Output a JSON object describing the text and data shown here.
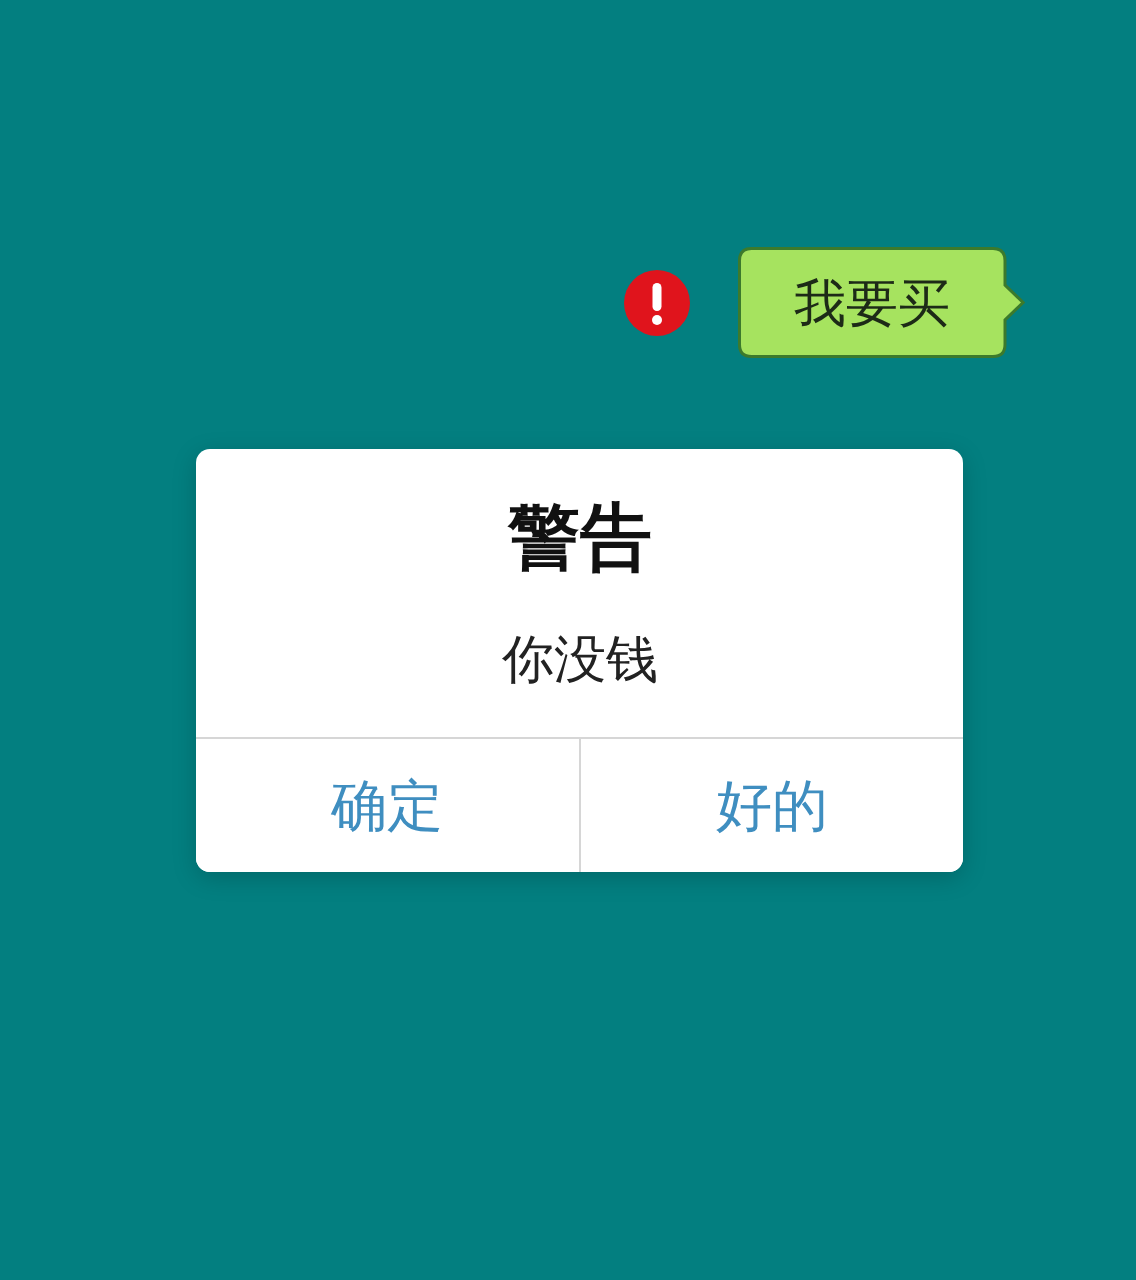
{
  "message": {
    "text": "我要买",
    "failed": true
  },
  "alert": {
    "title": "警告",
    "message": "你没钱",
    "buttons": [
      {
        "label": "确定"
      },
      {
        "label": "好的"
      }
    ]
  }
}
